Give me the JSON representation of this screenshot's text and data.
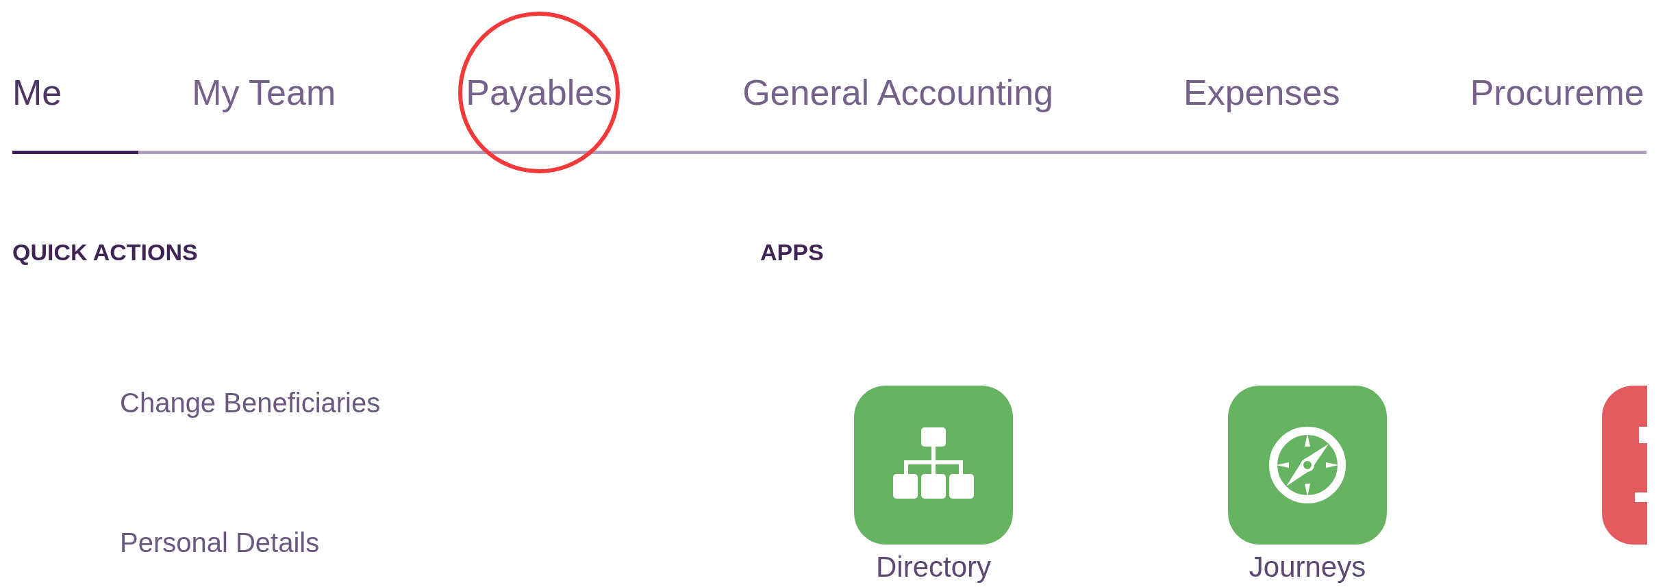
{
  "tabs": [
    {
      "label": "Me",
      "selected": true,
      "highlighted": false
    },
    {
      "label": "My Team",
      "selected": false,
      "highlighted": false
    },
    {
      "label": "Payables",
      "selected": false,
      "highlighted": true
    },
    {
      "label": "General Accounting",
      "selected": false,
      "highlighted": false
    },
    {
      "label": "Expenses",
      "selected": false,
      "highlighted": false
    },
    {
      "label": "Procureme",
      "selected": false,
      "highlighted": false
    }
  ],
  "quick_actions": {
    "title": "QUICK ACTIONS",
    "items": [
      "Change Beneficiaries",
      "Personal Details"
    ]
  },
  "apps": {
    "title": "APPS",
    "items": [
      {
        "label": "Directory",
        "kind": "org-chart",
        "color": "#66b462"
      },
      {
        "label": "Journeys",
        "kind": "compass",
        "color": "#66b462"
      },
      {
        "kind": "cut-off",
        "color": "#e35b5f"
      }
    ]
  }
}
